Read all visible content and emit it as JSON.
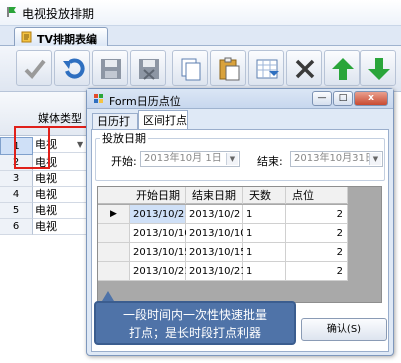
{
  "main": {
    "window_title": "电视投放排期",
    "tab_label": "TV排期表编辑",
    "grid_header": "媒体类型",
    "rows": [
      {
        "num": "1",
        "media": "电视"
      },
      {
        "num": "2",
        "media": "电视"
      },
      {
        "num": "3",
        "media": "电视"
      },
      {
        "num": "4",
        "media": "电视"
      },
      {
        "num": "5",
        "media": "电视"
      },
      {
        "num": "6",
        "media": "电视"
      }
    ]
  },
  "toolbar": {
    "icons": [
      "check-icon",
      "undo-icon",
      "save-icon",
      "save-close-icon",
      "copy-icon",
      "paste-icon",
      "import-icon",
      "delete-icon",
      "move-up-icon",
      "move-down-icon"
    ]
  },
  "dialog": {
    "title": "Form日历点位",
    "minimize": "—",
    "maximize": "□",
    "close": "x",
    "tabs": [
      "日历打点",
      "区间打点"
    ],
    "group_title": "投放日期",
    "start_label": "开始:",
    "start_value": "2013年10月 1日",
    "end_label": "结束:",
    "end_value": "2013年10月31日",
    "columns": [
      "开始日期",
      "结束日期",
      "天数",
      "点位"
    ],
    "rows": [
      {
        "marker": "▶",
        "start": "2013/10/2",
        "end": "2013/10/2",
        "days": "1",
        "points": "2"
      },
      {
        "marker": "",
        "start": "2013/10/10",
        "end": "2013/10/10",
        "days": "1",
        "points": "2"
      },
      {
        "marker": "",
        "start": "2013/10/15",
        "end": "2013/10/15",
        "days": "1",
        "points": "2"
      },
      {
        "marker": "",
        "start": "2013/10/21",
        "end": "2013/10/21",
        "days": "1",
        "points": "2"
      }
    ],
    "confirm_label": "确认(S)"
  },
  "callout": {
    "line1": "一段时间内一次性快速批量",
    "line2": "打点；是长时段打点利器"
  },
  "colors": {
    "highlight_red": "#e0201a",
    "callout_bg": "#4f73a8",
    "green_arrow": "#2aa53a"
  }
}
